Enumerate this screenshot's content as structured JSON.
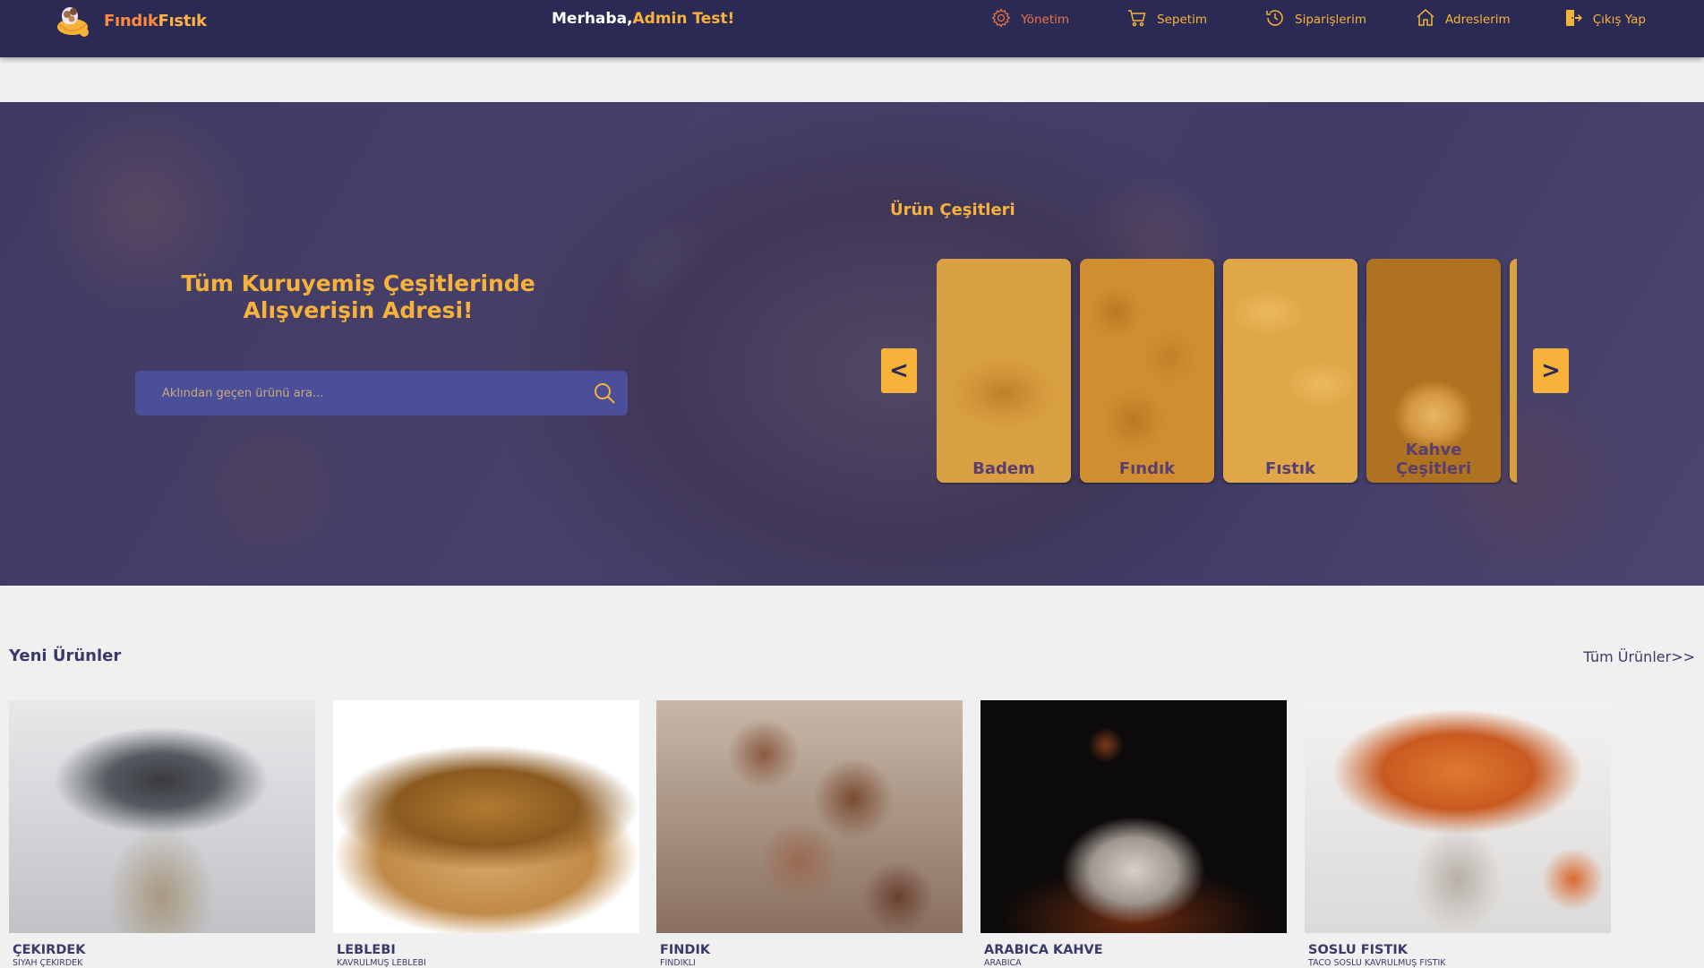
{
  "navbar": {
    "brand_part1": "Fındık",
    "brand_part2": "Fıstık",
    "greeting_prefix": "Merhaba,",
    "greeting_name": "Admin Test!",
    "items": [
      {
        "label": "Yönetim",
        "icon": "gear-icon"
      },
      {
        "label": "Sepetim",
        "icon": "cart-icon"
      },
      {
        "label": "Siparişlerim",
        "icon": "history-icon"
      },
      {
        "label": "Adreslerim",
        "icon": "home-icon"
      },
      {
        "label": "Çıkış Yap",
        "icon": "logout-icon"
      }
    ]
  },
  "hero": {
    "title": "Tüm Kuruyemiş Çeşitlerinde Alışverişin Adresi!",
    "search_placeholder": "Aklından geçen ürünü ara...",
    "categories_title": "Ürün Çeşitleri",
    "prev_label": "<",
    "next_label": ">",
    "categories": [
      {
        "label": "Badem"
      },
      {
        "label": "Fındık"
      },
      {
        "label": "Fıstık"
      },
      {
        "label": "Kahve Çeşitleri"
      },
      {
        "label": ""
      }
    ]
  },
  "new_products": {
    "title": "Yeni Ürünler",
    "all_link": "Tüm Ürünler>>",
    "items": [
      {
        "name": "ÇEKIRDEK",
        "desc": "SIYAH ÇEKIRDEK"
      },
      {
        "name": "LEBLEBI",
        "desc": "KAVRULMUŞ LEBLEBI"
      },
      {
        "name": "FINDIK",
        "desc": "FINDIKLI"
      },
      {
        "name": "ARABICA KAHVE",
        "desc": "ARABICA"
      },
      {
        "name": "SOSLU FISTIK",
        "desc": "TACO SOSLU KAVRULMUŞ FISTIK"
      }
    ]
  },
  "colors": {
    "navbar_bg": "#2b2a55",
    "accent": "#f7b23b",
    "accent_orange": "#e57444",
    "page_bg": "#f0f0f0",
    "text_dark": "#3a3a6a"
  }
}
